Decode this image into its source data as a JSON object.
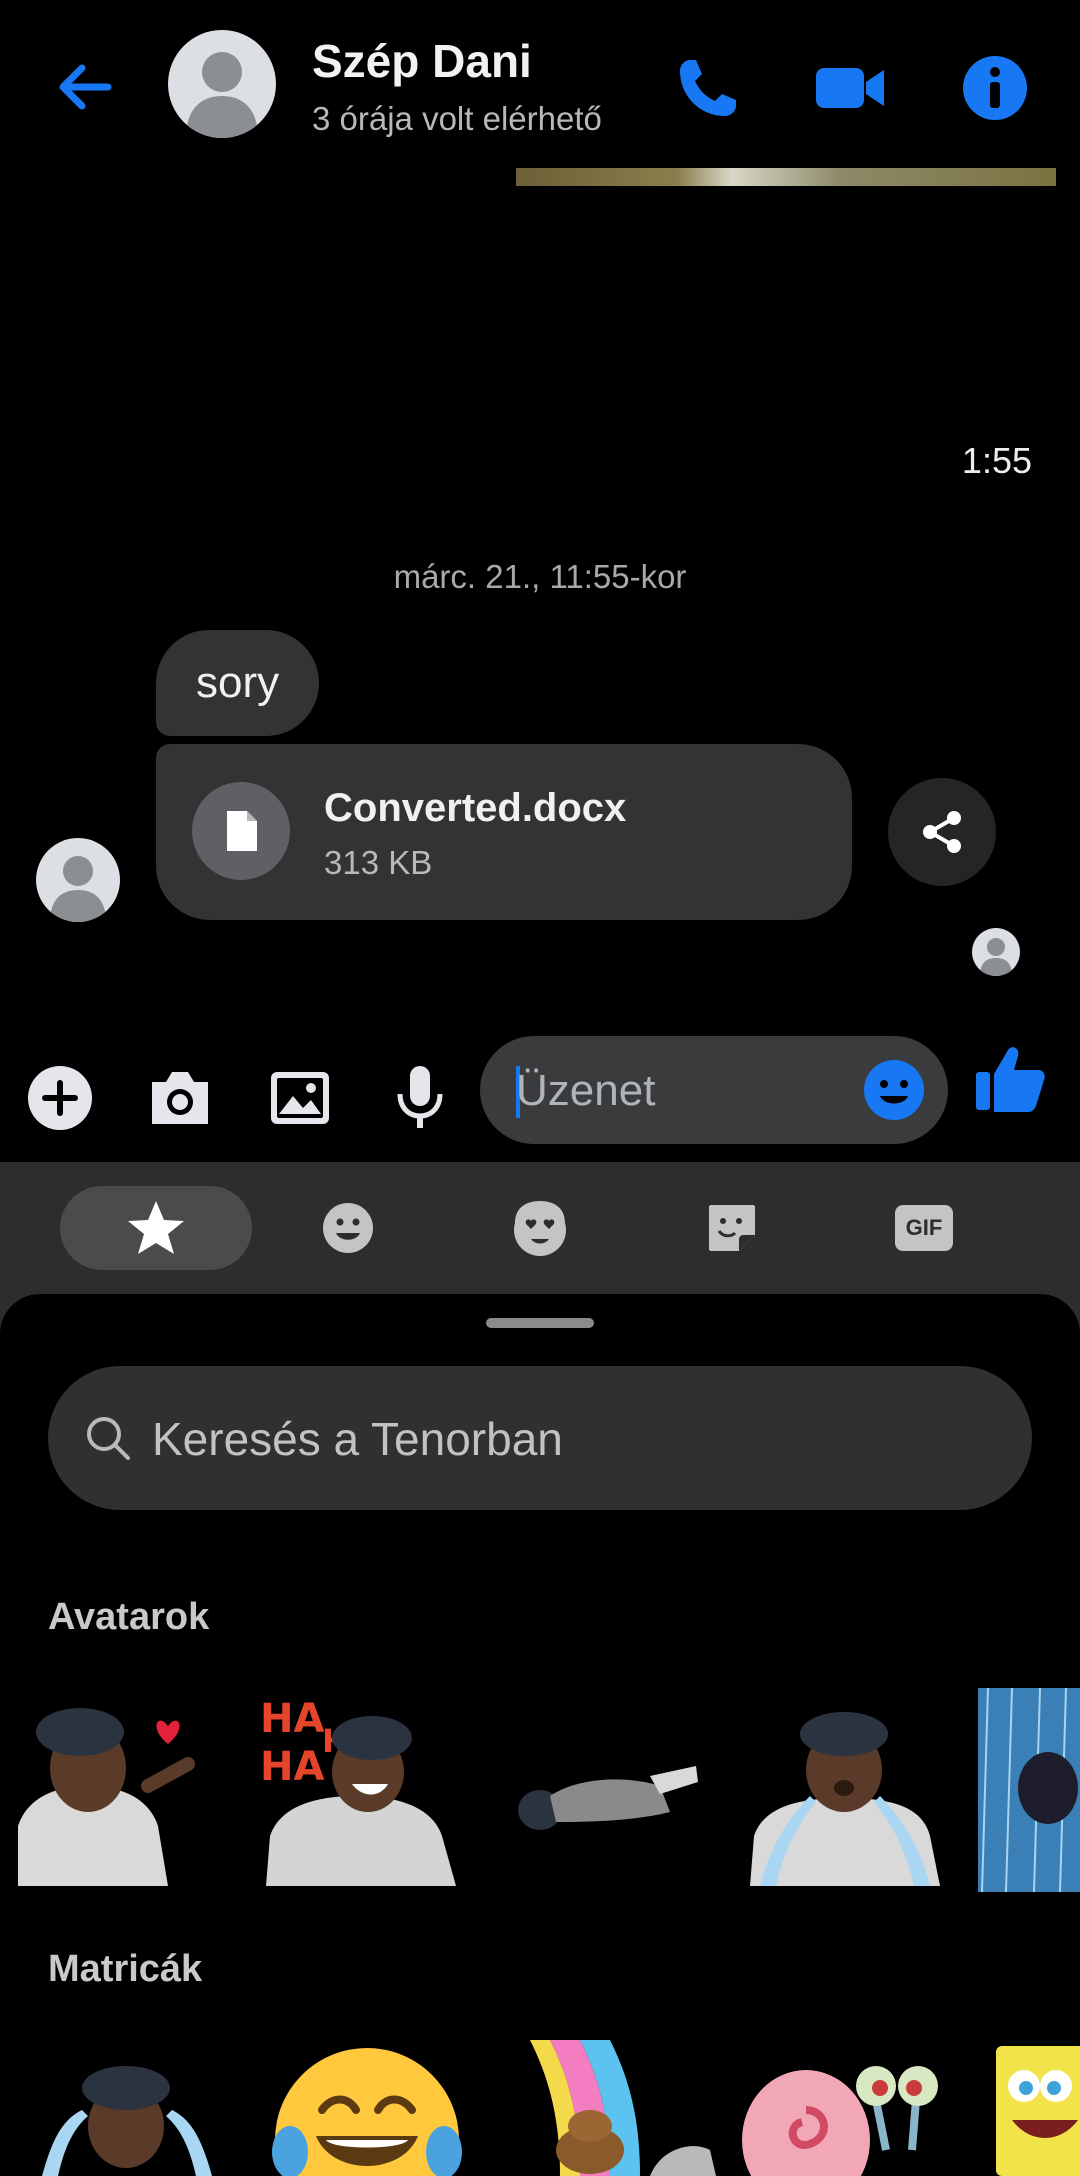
{
  "header": {
    "name": "Szép Dani",
    "status": "3 órája volt elérhető"
  },
  "chat": {
    "time_right": "1:55",
    "date_divider": "márc. 21., 11:55-kor",
    "message_text": "sory",
    "file": {
      "name": "Converted.docx",
      "size": "313 KB"
    }
  },
  "composer": {
    "placeholder": "Üzenet"
  },
  "panel": {
    "tabs": [
      {
        "icon": "star-icon",
        "active": true
      },
      {
        "icon": "smiley-icon",
        "active": false
      },
      {
        "icon": "avatar-heart-eyes-icon",
        "active": false
      },
      {
        "icon": "sticker-icon",
        "active": false
      },
      {
        "icon": "gif-icon",
        "active": false
      }
    ],
    "gif_label": "GIF",
    "search_placeholder": "Keresés a Tenorban",
    "sections": {
      "avatars": "Avatarok",
      "stickers": "Matricák"
    },
    "ha_text": "HA HA HA"
  },
  "colors": {
    "accent": "#1877f2",
    "bubble": "#333334",
    "panel": "#2d2d2e"
  }
}
